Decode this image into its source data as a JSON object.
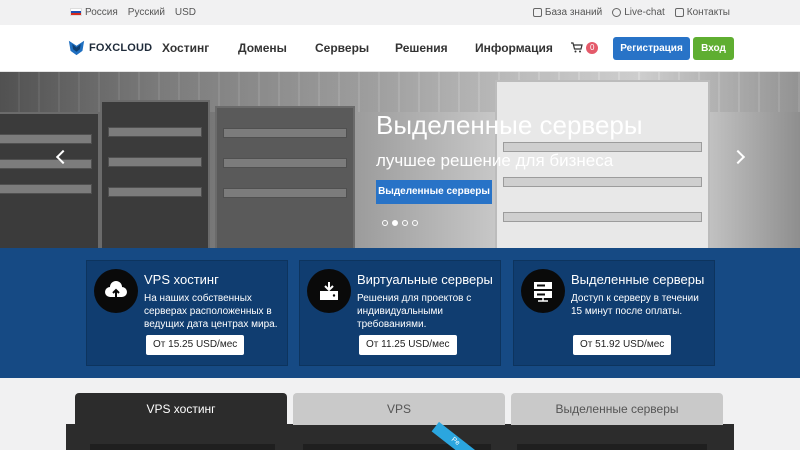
{
  "topbar": {
    "country": "Россия",
    "language": "Русский",
    "currency": "USD",
    "knowledge_base": "База знаний",
    "live_chat": "Live-chat",
    "contacts": "Контакты"
  },
  "header": {
    "logo": "FOXCLOUD",
    "nav": [
      "Хостинг",
      "Домены",
      "Серверы",
      "Решения",
      "Информация"
    ],
    "cart_count": "0",
    "register": "Регистрация",
    "login": "Вход"
  },
  "hero": {
    "title": "Выделенные серверы",
    "subtitle": "лучшее решение для бизнеса",
    "button": "Выделенные серверы",
    "slides_total": 4,
    "active_slide": 2
  },
  "services": [
    {
      "title": "VPS хостинг",
      "description": "На наших собственных серверах расположенных в ведущих дата центрах мира.",
      "price": "От 15.25 USD/мес",
      "icon": "cloud-upload-icon"
    },
    {
      "title": "Виртуальные серверы",
      "description": "Решения для проектов с индивидуальными требованиями.",
      "price": "От 11.25 USD/мес",
      "icon": "server-box-icon"
    },
    {
      "title": "Выделенные серверы",
      "description": "Доступ к серверу в течении 15 минут после оплаты.",
      "price": "От 51.92 USD/мес",
      "icon": "server-rack-icon"
    }
  ],
  "tabs": [
    "VPS хостинг",
    "VPS",
    "Выделенные серверы"
  ],
  "ribbon": "Pe",
  "colors": {
    "primary": "#2873c7",
    "login": "#5fae31",
    "band": "#164a84",
    "badge": "#e45a6a"
  }
}
